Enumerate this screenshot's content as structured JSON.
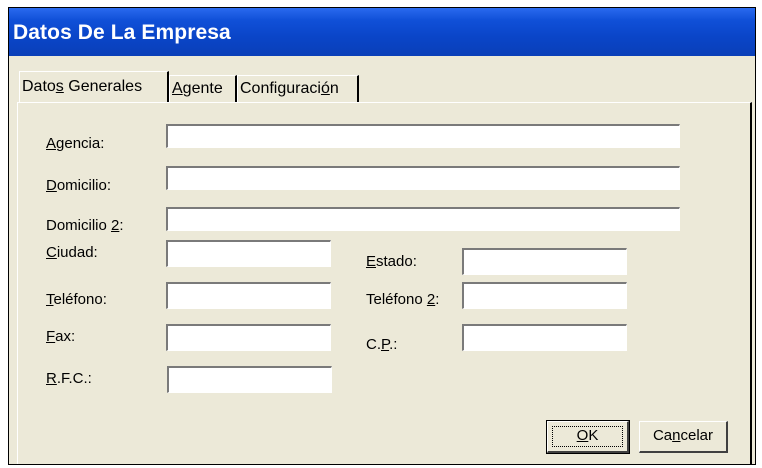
{
  "window": {
    "title": "Datos De La Empresa"
  },
  "tabs": [
    {
      "label_pre": "Dato",
      "label_ul": "s",
      "label_post": " Generales"
    },
    {
      "label_pre": "",
      "label_ul": "A",
      "label_post": "gente"
    },
    {
      "label_pre": "Configuraci",
      "label_ul": "ó",
      "label_post": "n"
    }
  ],
  "form": {
    "agencia": {
      "ul": "A",
      "rest": "gencia:",
      "value": ""
    },
    "domicilio": {
      "ul": "D",
      "rest": "omicilio:",
      "value": ""
    },
    "domicilio2": {
      "pre": "Domicilio ",
      "ul": "2",
      "rest": ":",
      "value": ""
    },
    "ciudad": {
      "ul": "C",
      "rest": "iudad:",
      "value": ""
    },
    "estado": {
      "ul": "E",
      "rest": "stado:",
      "value": ""
    },
    "telefono": {
      "ul": "T",
      "rest": "eléfono:",
      "value": ""
    },
    "telefono2": {
      "pre": "Teléfono ",
      "ul": "2",
      "rest": ":",
      "value": ""
    },
    "fax": {
      "ul": "F",
      "rest": "ax:",
      "value": ""
    },
    "cp": {
      "pre": "C.",
      "ul": "P",
      "rest": ".:",
      "value": ""
    },
    "rfc": {
      "ul": "R",
      "rest": ".F.C.:",
      "value": ""
    }
  },
  "buttons": {
    "ok": {
      "ul": "O",
      "rest": "K"
    },
    "cancel": {
      "pre": "Ca",
      "ul": "n",
      "rest": "celar"
    }
  }
}
